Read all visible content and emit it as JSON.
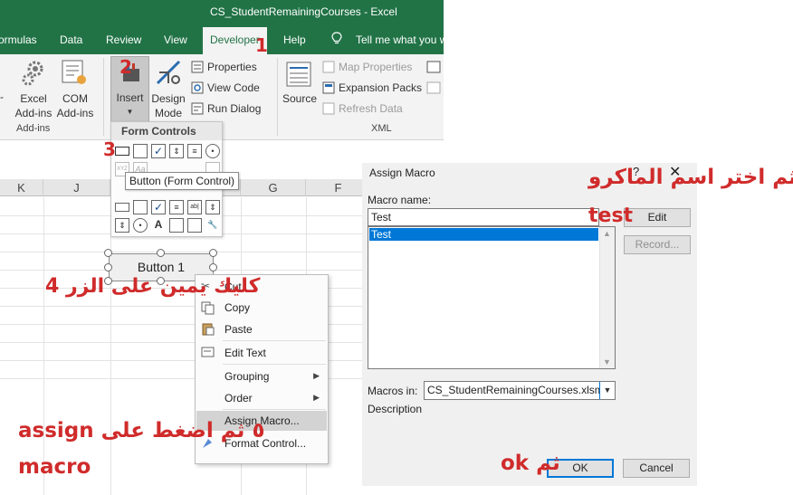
{
  "window": {
    "title": "CS_StudentRemainingCourses  -  Excel"
  },
  "menu": {
    "tabs": [
      "ormulas",
      "Data",
      "Review",
      "View",
      "Developer",
      "Help"
    ],
    "tell_me": "Tell me what you w"
  },
  "ribbon": {
    "excel_addins": "Excel Add-ins",
    "com_addins": "COM Add-ins",
    "addins_group": "Add-ins",
    "insert": "Insert",
    "design_mode": "Design Mode",
    "properties": "Properties",
    "view_code": "View Code",
    "run_dialog": "Run Dialog",
    "source": "Source",
    "map_properties": "Map Properties",
    "expansion_packs": "Expansion Packs",
    "refresh_data": "Refresh Data",
    "xml_group": "XML"
  },
  "form_controls": {
    "header": "Form Controls",
    "tooltip": "Button (Form Control)",
    "label_glyph": "A",
    "aa_glyph": "Aa",
    "xyz_glyph": "XYZ",
    "abl_glyph": "ab|"
  },
  "sheet": {
    "columns": [
      "K",
      "J",
      "G",
      "F"
    ],
    "button_label": "Button 1"
  },
  "context_menu": {
    "items": [
      "Cut",
      "Copy",
      "Paste",
      "Edit Text",
      "Grouping",
      "Order",
      "Assign Macro...",
      "Format Control..."
    ]
  },
  "dialog": {
    "title": "Assign Macro",
    "help": "?",
    "close": "✕",
    "macro_name_label": "Macro name:",
    "macro_name_value": "Test",
    "list_items": [
      "Test"
    ],
    "edit": "Edit",
    "record": "Record...",
    "macros_in_label": "Macros in:",
    "macros_in_value": "CS_StudentRemainingCourses.xlsm",
    "description_label": "Description",
    "ok": "OK",
    "cancel": "Cancel"
  },
  "annotations": {
    "step1": "1",
    "step2": "2",
    "step3": "3",
    "step4": "كليك يمين على الزر  4",
    "step5_line1": "assign ٥ ثم اضغط على",
    "step5_line2": "macro",
    "choose_name": "ثم اختر اسم الماكرو",
    "test": "test",
    "then_ok": "ok ثم"
  },
  "colors": {
    "excel_green": "#217346",
    "annotation_red": "#d02b2b",
    "selection_blue": "#0078d7"
  }
}
